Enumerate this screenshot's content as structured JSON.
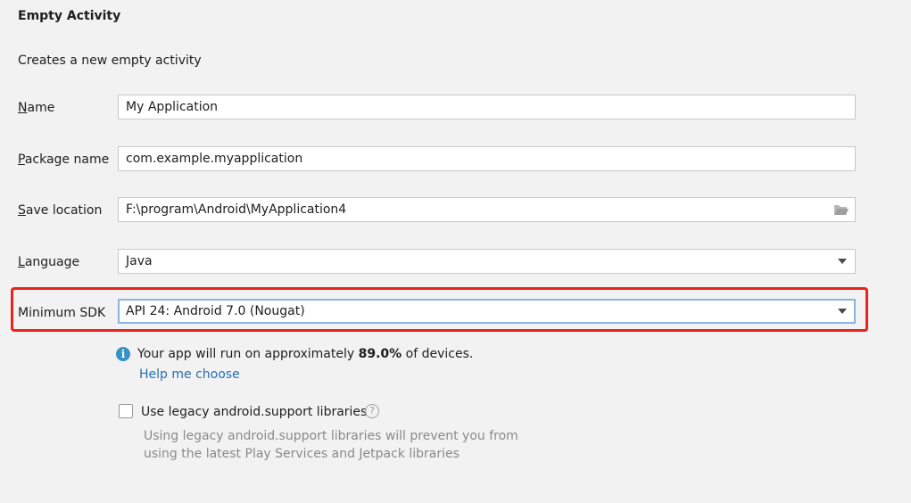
{
  "header": {
    "title": "Empty Activity",
    "subtitle": "Creates a new empty activity"
  },
  "form": {
    "name": {
      "label_mnemonic": "N",
      "label_rest": "ame",
      "value": "My Application"
    },
    "package_name": {
      "label_mnemonic": "P",
      "label_rest": "ackage name",
      "value": "com.example.myapplication"
    },
    "save_location": {
      "label_mnemonic": "S",
      "label_rest": "ave location",
      "value": "F:\\program\\Android\\MyApplication4",
      "browse_icon": "folder-icon"
    },
    "language": {
      "label_mnemonic": "L",
      "label_rest": "anguage",
      "value": "Java",
      "icon": "chevron-down-icon"
    },
    "minimum_sdk": {
      "label": "Minimum SDK",
      "value": "API 24: Android 7.0 (Nougat)",
      "icon": "chevron-down-icon"
    }
  },
  "sdk_info": {
    "icon": "info-icon",
    "icon_glyph": "i",
    "text_before": "Your app will run on approximately ",
    "percentage": "89.0%",
    "text_after": " of devices.",
    "help_link": "Help me choose"
  },
  "legacy": {
    "checkbox_label": "Use legacy android.support libraries",
    "checked": false,
    "help_glyph": "?",
    "note": "Using legacy android.support libraries will prevent you from using the latest Play Services and Jetpack libraries"
  },
  "colors": {
    "background": "#f2f2f2",
    "highlight": "#e8231b",
    "focus_border": "#8bb3e4",
    "link": "#2470b3",
    "info": "#3592c4"
  }
}
